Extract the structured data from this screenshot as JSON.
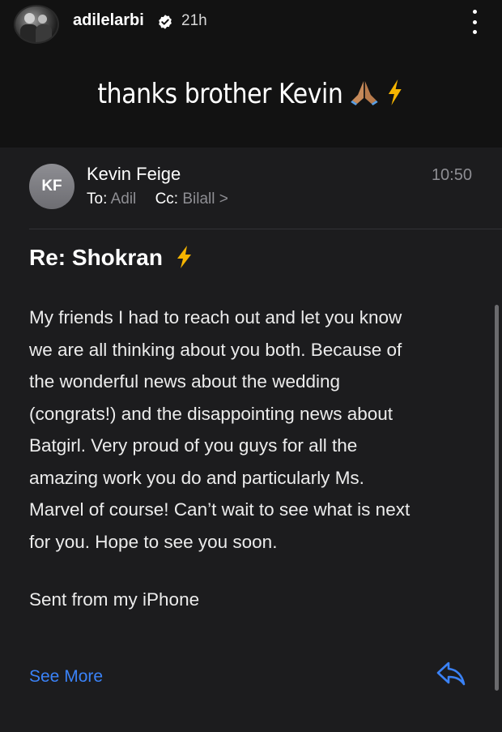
{
  "story": {
    "username": "adilelarbi",
    "time_ago": "21h",
    "caption": "thanks brother Kevin",
    "verified_icon": "verified-badge-icon",
    "more_icon": "more-vertical-icon"
  },
  "email": {
    "avatar_initials": "KF",
    "sender_name": "Kevin Feige",
    "to_label": "To:",
    "to_value": "Adil",
    "cc_label": "Cc:",
    "cc_value": "Bilall >",
    "time": "10:50",
    "subject": "Re: Shokran",
    "body": "My friends I had to reach out and let you know\nwe are all thinking about you both. Because of\nthe wonderful news about the wedding\n(congrats!) and the disappointing news about\nBatgirl. Very proud of you guys for all the\namazing work you do and particularly Ms.\nMarvel of course!  Can’t wait to see what is next\nfor you. Hope to see you soon.",
    "signature": "Sent from my iPhone",
    "see_more": "See More",
    "reply_icon": "reply-arrow-icon"
  },
  "colors": {
    "background": "#121212",
    "card": "#1c1c1e",
    "link_blue": "#3a82f7",
    "muted": "#8e8e93",
    "bolt": "#f5b400"
  }
}
